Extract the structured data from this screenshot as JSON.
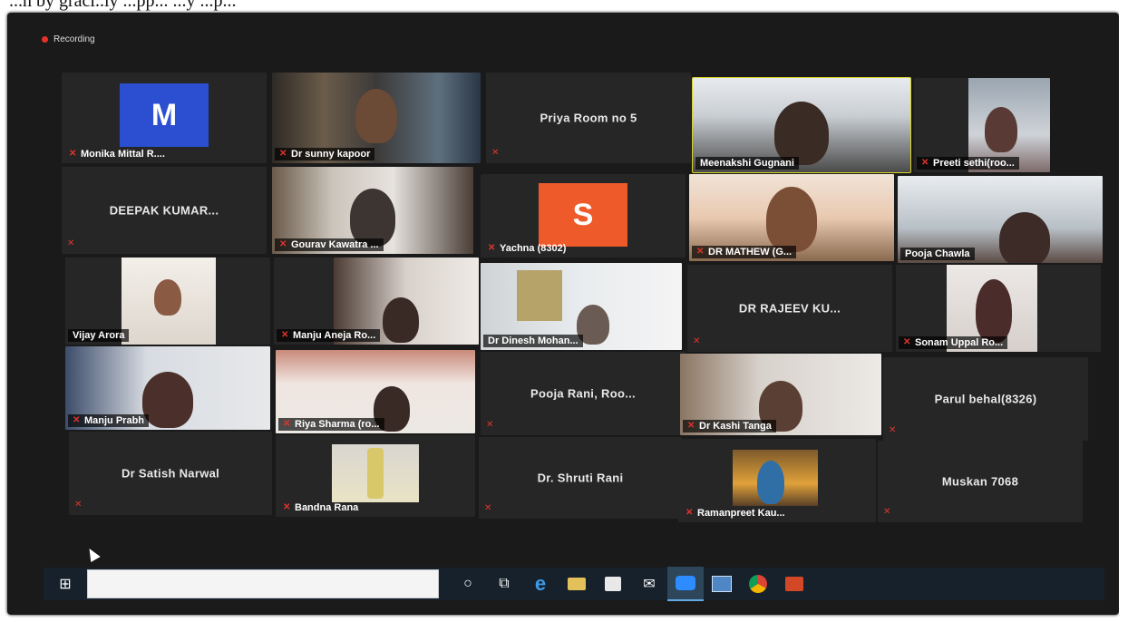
{
  "caption": "...n by graci..ly ...pp... ...y ...p...",
  "recording_label": "Recording",
  "tiles": {
    "monika": {
      "label": "Monika Mittal R....",
      "initial": "M",
      "avatar_color": "#2c4fd1"
    },
    "sunny": {
      "label": "Dr sunny kapoor"
    },
    "priya": {
      "name": "Priya Room no 5"
    },
    "meenakshi": {
      "label": "Meenakshi Gugnani"
    },
    "preeti": {
      "label": "Preeti sethi(roo..."
    },
    "deepak": {
      "name": "DEEPAK KUMAR..."
    },
    "gourav": {
      "label": "Gourav Kawatra ..."
    },
    "yachna": {
      "label": "Yachna   (8302)",
      "initial": "S",
      "avatar_color": "#ee5a2a"
    },
    "mathew": {
      "label": "DR MATHEW (G..."
    },
    "pooja_chawla": {
      "label": "Pooja Chawla"
    },
    "vijay": {
      "label": "Vijay Arora"
    },
    "manju_ro": {
      "label": "Manju Aneja Ro..."
    },
    "dinesh": {
      "label": "Dr Dinesh Mohan..."
    },
    "rajeev": {
      "name": "DR RAJEEV KU..."
    },
    "sonam": {
      "label": "Sonam Uppal Ro..."
    },
    "manju_prabh": {
      "label": "Manju Prabh"
    },
    "riya": {
      "label": "Riya Sharma (ro..."
    },
    "pooja_rani": {
      "name": "Pooja Rani, Roo..."
    },
    "kashi": {
      "label": "Dr Kashi Tanga"
    },
    "parul": {
      "name": "Parul behal(8326)"
    },
    "satish": {
      "name": "Dr Satish Narwal"
    },
    "bandna": {
      "label": "Bandna Rana"
    },
    "shruti": {
      "name": "Dr. Shruti Rani"
    },
    "ramanpreet": {
      "label": "Ramanpreet Kau..."
    },
    "muskan": {
      "name": "Muskan 7068"
    }
  },
  "taskbar": {
    "icons": [
      "windows-start",
      "task-view-circle",
      "task-view",
      "edge",
      "file-explorer",
      "store",
      "mail",
      "zoom",
      "photos",
      "chrome",
      "powerpoint"
    ]
  }
}
